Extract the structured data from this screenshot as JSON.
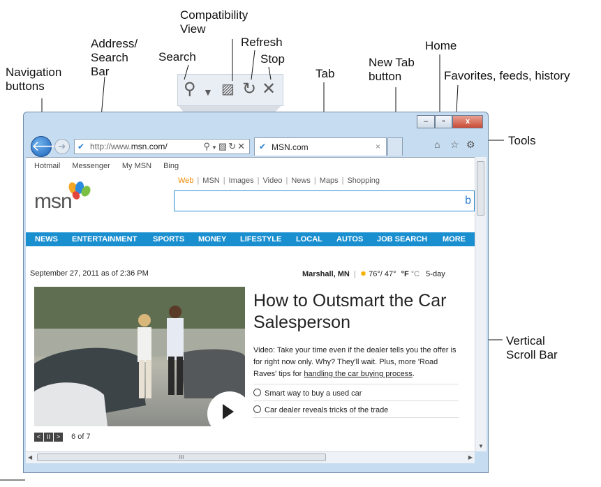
{
  "callouts": {
    "navigation": "Navigation\nbuttons",
    "address": "Address/\nSearch\nBar",
    "search": "Search",
    "compat": "Compatibility\nView",
    "refresh": "Refresh",
    "stop": "Stop",
    "tab": "Tab",
    "newtab": "New Tab\nbutton",
    "home": "Home",
    "favorites": "Favorites, feeds, history",
    "tools": "Tools",
    "vscroll": "Vertical\nScroll Bar"
  },
  "window": {
    "caption_buttons": [
      "‒",
      "▫",
      "x"
    ]
  },
  "toolbar": {
    "url_prefix": "http://www.",
    "url_domain": "msn.com/",
    "tab_title": "MSN.com",
    "tab_close": "×"
  },
  "page": {
    "top_links": [
      "Hotmail",
      "Messenger",
      "My MSN",
      "Bing"
    ],
    "logo": "msn",
    "search_tabs": [
      "Web",
      "MSN",
      "Images",
      "Video",
      "News",
      "Maps",
      "Shopping"
    ],
    "nav": [
      "NEWS",
      "ENTERTAINMENT",
      "SPORTS",
      "MONEY",
      "LIFESTYLE",
      "LOCAL",
      "AUTOS",
      "JOB SEARCH",
      "MORE"
    ],
    "date": "September 27, 2011 as of 2:36 PM",
    "weather_city": "Marshall, MN",
    "weather_temp": "76°/ 47°",
    "weather_units_f": "°F",
    "weather_units_c": "°C",
    "weather_forecast": "5-day",
    "headline": "How to Outsmart the Car Salesperson",
    "story_text": "Video: Take your time even if the dealer tells you the offer is for right now only. Why? They'll wait. Plus, more 'Road Raves' tips for ",
    "story_link": "handling the car buying process",
    "story_end": ".",
    "related": [
      "Smart way to buy a used car",
      "Car dealer reveals tricks of the trade"
    ],
    "pager_count": "6 of 7"
  },
  "hscroll_grip": "III"
}
